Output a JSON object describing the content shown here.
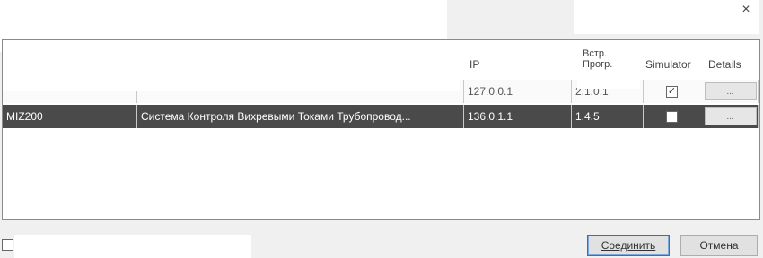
{
  "window": {
    "close_glyph": "×",
    "close_icon": "close-icon"
  },
  "table": {
    "headers": {
      "ip": "IP",
      "firmware_line1": "Встр.",
      "firmware_line2": "Прогр.",
      "simulator": "Simulator",
      "details": "Details"
    },
    "rows": [
      {
        "name": "",
        "description": "",
        "ip": "127.0.0.1",
        "firmware": "2.1.0.1",
        "simulator": true,
        "details_label": "..."
      },
      {
        "name": "MIZ200",
        "description": "Система Контроля Вихревыми Токами Трубопровод...",
        "ip": "136.0.1.1",
        "firmware": "1.4.5",
        "simulator": false,
        "details_label": "..."
      }
    ]
  },
  "footer": {
    "connect_label": "Соединить",
    "cancel_label": "Отмена"
  }
}
